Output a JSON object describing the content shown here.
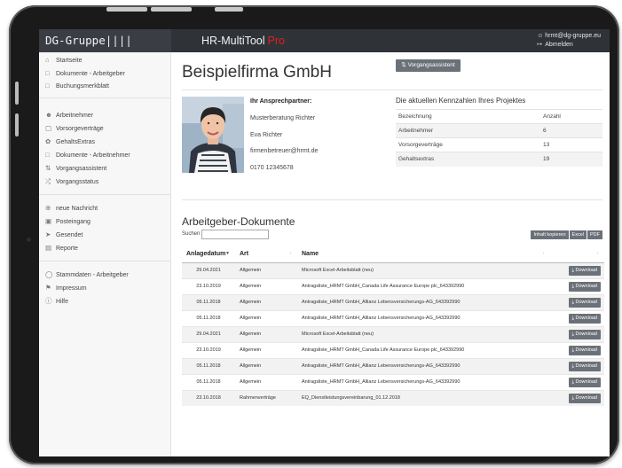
{
  "header": {
    "brand": "DG-Gruppe||||",
    "app_title": "HR-MultiTool",
    "app_title_accent": "Pro",
    "user_email": "hrmt@dg-gruppe.eu",
    "logout": "Abmelden"
  },
  "sidebar": {
    "group1": [
      {
        "label": "Startseite",
        "icon": "home-icon"
      },
      {
        "label": "Dokumente - Arbeitgeber",
        "icon": "document-icon"
      },
      {
        "label": "Buchungsmerkblatt",
        "icon": "document-icon"
      }
    ],
    "group2": [
      {
        "label": "Arbeitnehmer",
        "icon": "users-icon"
      },
      {
        "label": "Vorsorgeverträge",
        "icon": "folder-icon"
      },
      {
        "label": "GehaltsExtras",
        "icon": "gift-icon"
      },
      {
        "label": "Dokumente - Arbeitnehmer",
        "icon": "document-icon"
      },
      {
        "label": "Vorgangsassistent",
        "icon": "swap-icon"
      },
      {
        "label": "Vorgangsstatus",
        "icon": "shuffle-icon"
      }
    ],
    "group3": [
      {
        "label": "neue Nachricht",
        "icon": "plus-circle-icon"
      },
      {
        "label": "Posteingang",
        "icon": "inbox-icon"
      },
      {
        "label": "Gesendet",
        "icon": "send-icon"
      },
      {
        "label": "Reporte",
        "icon": "report-icon"
      }
    ],
    "group4": [
      {
        "label": "Stammdaten - Arbeitgeber",
        "icon": "globe-icon"
      },
      {
        "label": "Impressum",
        "icon": "flag-icon"
      },
      {
        "label": "Hilfe",
        "icon": "help-icon"
      }
    ]
  },
  "main": {
    "company_name": "Beispielfirma GmbH",
    "assistant_button": "Vorgangsassistent",
    "contact": {
      "title": "Ihr Ansprechpartner:",
      "company": "Musterberatung Richter",
      "name": "Eva Richter",
      "email": "firmenbetreuer@hrmt.de",
      "phone": "0170 12345678"
    },
    "kpi": {
      "title": "Die aktuellen Kennzahlen Ihres Projektes",
      "col_label": "Bezeichnung",
      "col_count": "Anzahl",
      "rows": [
        {
          "label": "Arbeitnehmer",
          "value": "6"
        },
        {
          "label": "Vorsorgeverträge",
          "value": "13"
        },
        {
          "label": "Gehaltsextras",
          "value": "19"
        }
      ]
    },
    "documents": {
      "title": "Arbeitgeber-Dokumente",
      "search_label": "Suchen",
      "search_value": "",
      "tools": [
        "Inhalt kopieren",
        "Excel",
        "PDF"
      ],
      "columns": [
        "Anlagedatum",
        "Art",
        "Name"
      ],
      "download_label": "Download",
      "rows": [
        {
          "date": "29.04.2021",
          "type": "Allgemein",
          "name": "Microsoft Excel-Arbeitsblatt (neu)"
        },
        {
          "date": "23.10.2019",
          "type": "Allgemein",
          "name": "Antragsliste_HRMT GmbH_Canada Life Assurance Europe plc_643392990"
        },
        {
          "date": "05.11.2018",
          "type": "Allgemein",
          "name": "Antragsliste_HRMT GmbH_Allianz Lebensversicherungs-AG_643392990"
        },
        {
          "date": "05.11.2018",
          "type": "Allgemein",
          "name": "Antragsliste_HRMT GmbH_Allianz Lebensversicherungs-AG_643392990"
        },
        {
          "date": "29.04.2021",
          "type": "Allgemein",
          "name": "Microsoft Excel-Arbeitsblatt (neu)"
        },
        {
          "date": "23.10.2019",
          "type": "Allgemein",
          "name": "Antragsliste_HRMT GmbH_Canada Life Assurance Europe plc_643392990"
        },
        {
          "date": "05.11.2018",
          "type": "Allgemein",
          "name": "Antragsliste_HRMT GmbH_Allianz Lebensversicherungs-AG_643392990"
        },
        {
          "date": "05.11.2018",
          "type": "Allgemein",
          "name": "Antragsliste_HRMT GmbH_Allianz Lebensversicherungs-AG_643392990"
        },
        {
          "date": "23.10.2018",
          "type": "Rahmenverträge",
          "name": "EQ_Dienstleistungsvereinbarung_01.12.2018"
        }
      ]
    }
  },
  "colors": {
    "topbar": "#2f3338",
    "brand_bg": "#3a3e44",
    "accent_pro": "#e02020",
    "button": "#6b7178"
  }
}
